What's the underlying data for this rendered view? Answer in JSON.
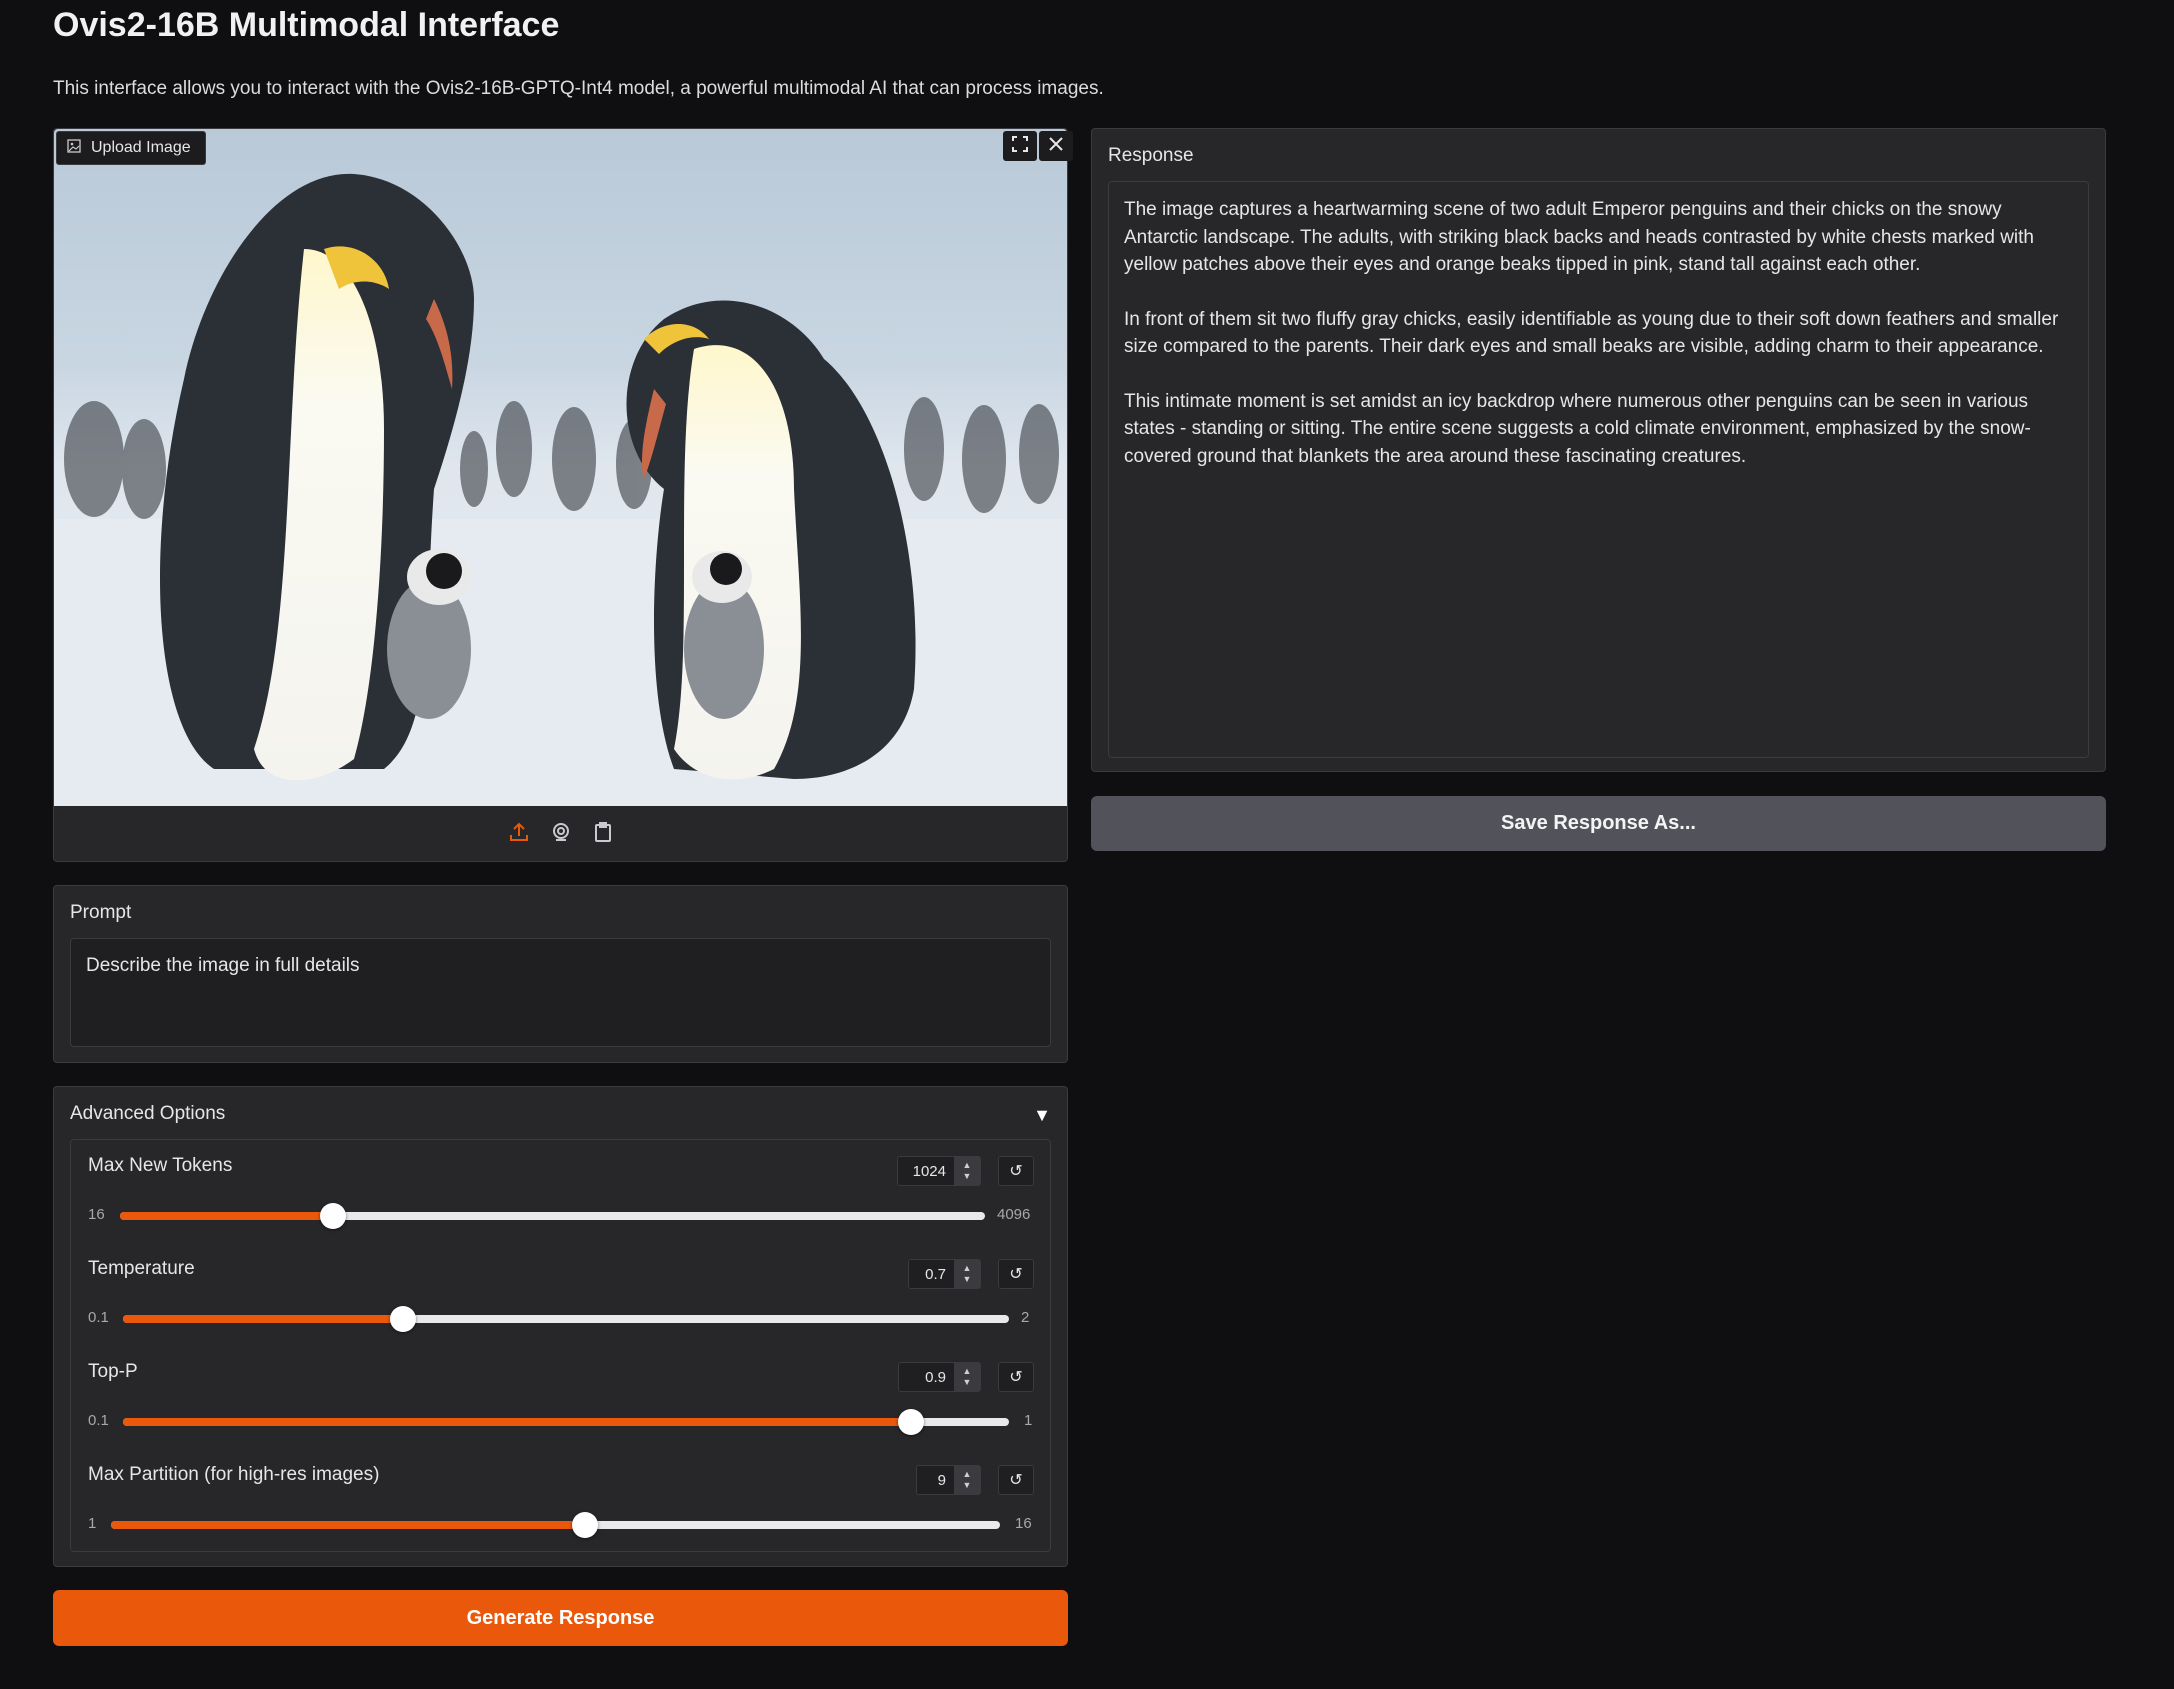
{
  "header": {
    "title": "Ovis2-16B Multimodal Interface",
    "subtitle": "This interface allows you to interact with the Ovis2-16B-GPTQ-Int4 model, a powerful multimodal AI that can process images."
  },
  "image_input": {
    "label": "Upload Image",
    "image_description": "Two adult emperor penguins with two gray chicks on snowy ground, colony in background",
    "tools": [
      "upload-icon",
      "webcam-icon",
      "clipboard-icon"
    ],
    "corner_buttons": [
      "fullscreen-icon",
      "close-icon"
    ]
  },
  "prompt": {
    "label": "Prompt",
    "value": "Describe the image in full details"
  },
  "advanced": {
    "label": "Advanced Options",
    "caret": "▼",
    "sliders": [
      {
        "label": "Max New Tokens",
        "value": "1024",
        "min": "16",
        "max": "4096",
        "fraction": 0.246
      },
      {
        "label": "Temperature",
        "value": "0.7",
        "min": "0.1",
        "max": "2",
        "fraction": 0.316
      },
      {
        "label": "Top-P",
        "value": "0.9",
        "min": "0.1",
        "max": "1",
        "fraction": 0.889
      },
      {
        "label": "Max Partition (for high-res images)",
        "value": "9",
        "min": "1",
        "max": "16",
        "fraction": 0.533
      }
    ],
    "reset_glyph": "↺"
  },
  "generate_label": "Generate Response",
  "response": {
    "label": "Response",
    "paragraphs": [
      "The image captures a heartwarming scene of two adult Emperor penguins and their chicks on the snowy Antarctic landscape. The adults, with striking black backs and heads contrasted by white chests marked with yellow patches above their eyes and orange beaks tipped in pink, stand tall against each other.",
      "In front of them sit two fluffy gray chicks, easily identifiable as young due to their soft down feathers and smaller size compared to the parents. Their dark eyes and small beaks are visible, adding charm to their appearance.",
      "This intimate moment is set amidst an icy backdrop where numerous other penguins can be seen in various states - standing or sitting. The entire scene suggests a cold climate environment, emphasized by the snow-covered ground that blankets the area around these fascinating creatures."
    ]
  },
  "save_label": "Save Response As...",
  "colors": {
    "accent": "#ea580c",
    "background": "#0f0f11",
    "panel": "#27272a",
    "secondary_button": "#52525b"
  }
}
